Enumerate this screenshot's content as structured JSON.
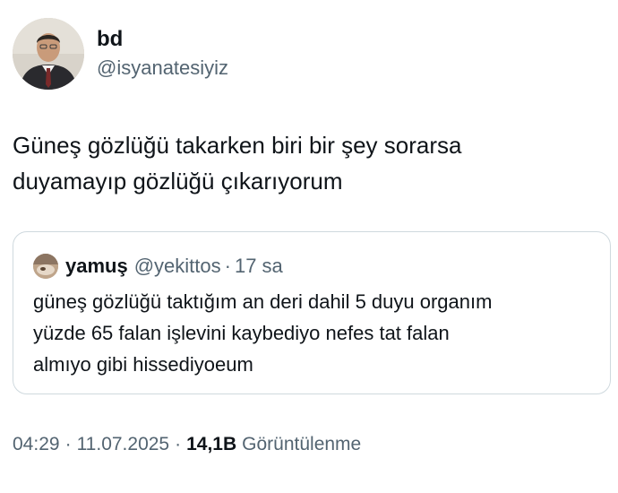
{
  "tweet": {
    "author": {
      "display_name": "bd",
      "handle": "@isyanatesiyiz",
      "avatar_icon": "profile-photo-icon"
    },
    "text": "Güneş gözlüğü takarken biri bir şey sorarsa\nduyamayıp gözlüğü çıkarıyorum",
    "time": "04:29",
    "separator": "·",
    "date": "11.07.2025",
    "views_count": "14,1B",
    "views_label": "Görüntülenme"
  },
  "quoted_tweet": {
    "display_name": "yamuş",
    "handle": "@yekittos",
    "separator": "·",
    "time_ago": "17 sa",
    "avatar_icon": "profile-photo-icon",
    "text": "güneş gözlüğü taktığım an deri dahil 5 duyu organım\nyüzde 65 falan işlevini kaybediyo nefes tat falan\nalmıyo gibi hissediyoeum"
  },
  "colors": {
    "text_primary": "#0f1419",
    "text_secondary": "#536471",
    "quote_border": "#cfd9de",
    "background": "#ffffff"
  }
}
